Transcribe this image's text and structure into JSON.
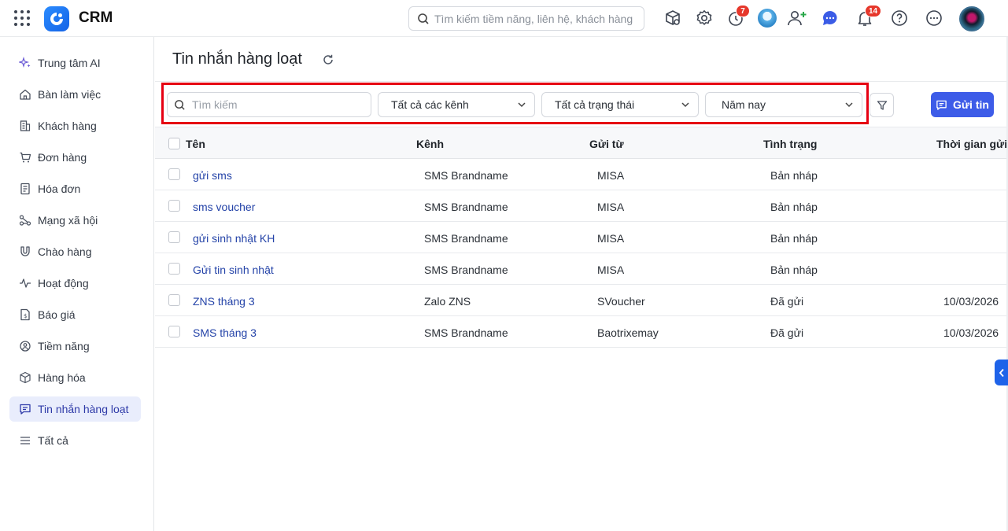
{
  "app": {
    "title": "CRM"
  },
  "header": {
    "search_placeholder": "Tìm kiếm tiềm năng, liên hệ, khách hàng",
    "timer_badge": "7",
    "notification_badge": "14"
  },
  "sidebar": {
    "items": [
      {
        "label": "Trung tâm AI",
        "icon": "sparkle-icon"
      },
      {
        "label": "Bàn làm việc",
        "icon": "home-icon"
      },
      {
        "label": "Khách hàng",
        "icon": "building-icon"
      },
      {
        "label": "Đơn hàng",
        "icon": "cart-icon"
      },
      {
        "label": "Hóa đơn",
        "icon": "invoice-icon"
      },
      {
        "label": "Mạng xã hội",
        "icon": "network-icon"
      },
      {
        "label": "Chào hàng",
        "icon": "magnet-icon"
      },
      {
        "label": "Hoạt động",
        "icon": "pulse-icon"
      },
      {
        "label": "Báo giá",
        "icon": "quote-icon"
      },
      {
        "label": "Tiềm năng",
        "icon": "target-icon"
      },
      {
        "label": "Hàng hóa",
        "icon": "box-icon"
      },
      {
        "label": "Tin nhắn hàng loạt",
        "icon": "message-icon",
        "active": true
      },
      {
        "label": "Tất cả",
        "icon": "menu-icon"
      }
    ]
  },
  "page": {
    "title": "Tin nhắn hàng loạt"
  },
  "filters": {
    "search_placeholder": "Tìm kiếm",
    "channel": "Tất cả các kênh",
    "status": "Tất cả trạng thái",
    "period": "Năm nay"
  },
  "actions": {
    "send_label": "Gửi tin"
  },
  "table": {
    "columns": [
      "Tên",
      "Kênh",
      "Gửi từ",
      "Tình trạng",
      "Thời gian gửi"
    ],
    "rows": [
      {
        "name": "gửi sms",
        "channel": "SMS Brandname",
        "from": "MISA",
        "status": "Bản nháp",
        "time": ""
      },
      {
        "name": "sms voucher",
        "channel": "SMS Brandname",
        "from": "MISA",
        "status": "Bản nháp",
        "time": ""
      },
      {
        "name": "gửi sinh nhật KH",
        "channel": "SMS Brandname",
        "from": "MISA",
        "status": "Bản nháp",
        "time": ""
      },
      {
        "name": "Gửi tin sinh nhật",
        "channel": "SMS Brandname",
        "from": "MISA",
        "status": "Bản nháp",
        "time": ""
      },
      {
        "name": "ZNS tháng 3",
        "channel": "Zalo ZNS",
        "from": "SVoucher",
        "status": "Đã gửi",
        "time": "10/03/2026"
      },
      {
        "name": "SMS tháng 3",
        "channel": "SMS Brandname",
        "from": "Baotrixemay",
        "status": "Đã gửi",
        "time": "10/03/2026"
      }
    ]
  },
  "colors": {
    "accent": "#3d5ce8",
    "highlight": "#e60012",
    "link": "#2443a8",
    "badge": "#e6372b"
  }
}
